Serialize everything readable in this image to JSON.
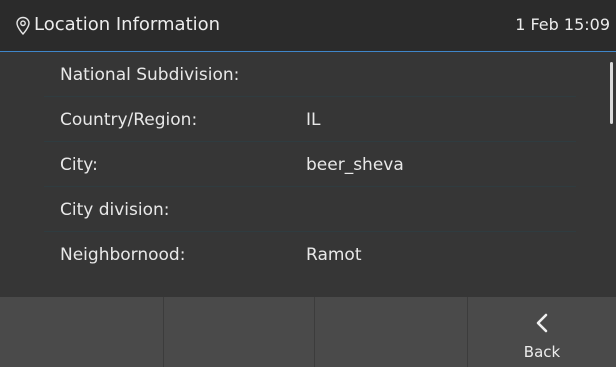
{
  "header": {
    "title": "Location Information",
    "datetime": "1 Feb 15:09",
    "icon": "location-pin-icon"
  },
  "rows": [
    {
      "label": "National Subdivision:",
      "value": ""
    },
    {
      "label": "Country/Region:",
      "value": "IL"
    },
    {
      "label": "City:",
      "value": "beer_sheva"
    },
    {
      "label": "City division:",
      "value": ""
    },
    {
      "label": "Neighbornood:",
      "value": "Ramot"
    }
  ],
  "softkeys": [
    {
      "label": ""
    },
    {
      "label": ""
    },
    {
      "label": ""
    },
    {
      "label": "Back",
      "icon": "chevron-left-icon"
    }
  ],
  "colors": {
    "accent": "#3f86c9",
    "background": "#363636",
    "softkey_bar": "#4a4a4a"
  }
}
